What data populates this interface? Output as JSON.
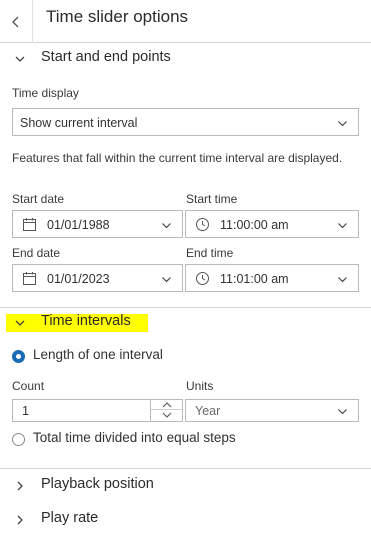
{
  "header": {
    "title": "Time slider options"
  },
  "start_end": {
    "title": "Start and end points",
    "time_display_label": "Time display",
    "time_display_value": "Show current interval",
    "description": "Features that fall within the current time interval are displayed.",
    "start_date_label": "Start date",
    "start_date_value": "01/01/1988",
    "start_time_label": "Start time",
    "start_time_value": "11:00:00 am",
    "end_date_label": "End date",
    "end_date_value": "01/01/2023",
    "end_time_label": "End time",
    "end_time_value": "11:01:00 am"
  },
  "time_intervals": {
    "title": "Time intervals",
    "highlight_color": "#ffff00",
    "option_length": "Length of one interval",
    "count_label": "Count",
    "count_value": "1",
    "units_label": "Units",
    "units_value": "Year",
    "option_divided": "Total time divided into equal steps"
  },
  "playback": {
    "title": "Playback position"
  },
  "play_rate": {
    "title": "Play rate"
  },
  "colors": {
    "accent": "#1a6bb8"
  }
}
